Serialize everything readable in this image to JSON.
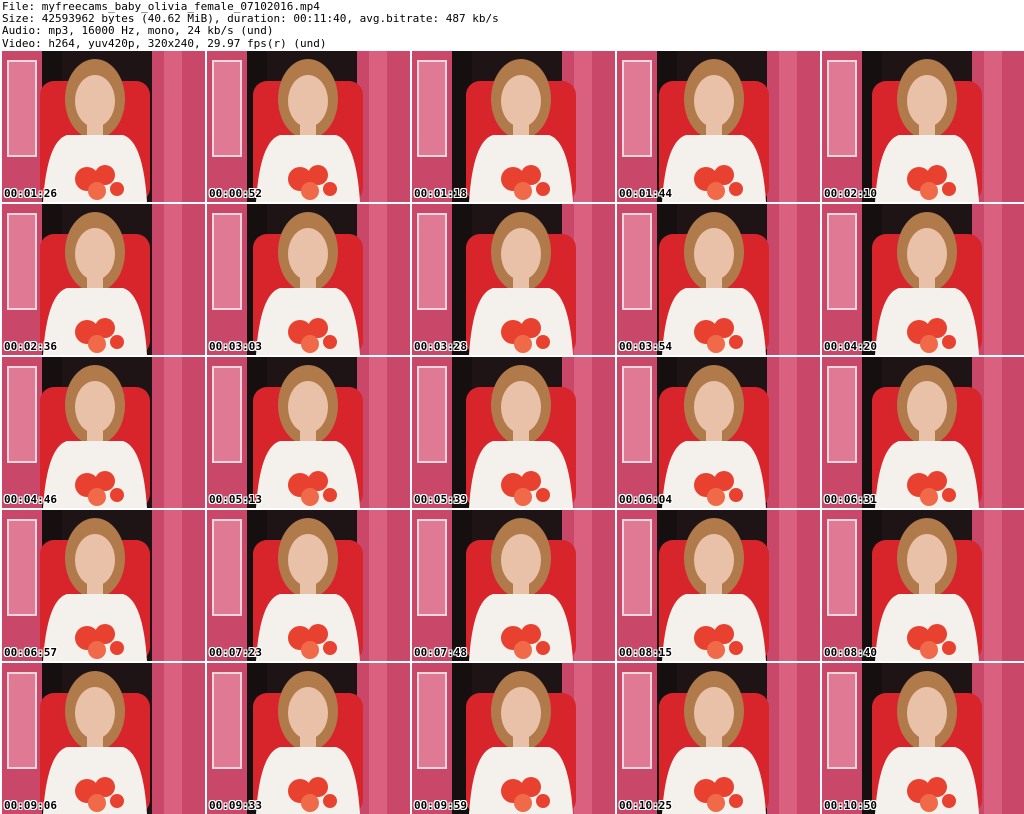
{
  "header": {
    "line1": "File: myfreecams_baby_olivia_female_07102016.mp4",
    "line2": "Size: 42593962 bytes (40.62 MiB), duration: 00:11:40, avg.bitrate: 487 kb/s",
    "line3": "Audio: mp3, 16000 Hz, mono, 24 kb/s (und)",
    "line4": "Video: h264, yuv420p, 320x240, 29.97 fps(r) (und)"
  },
  "colors": {
    "wall_pink": "#c9486a",
    "chair_red": "#d8252c",
    "top_white": "#f4f0ec",
    "print_red": "#e8412f",
    "hair": "#b07a4a",
    "skin": "#e9c1a8",
    "dark_bg": "#1e1416"
  },
  "thumbnails": [
    {
      "time": "00:01:26"
    },
    {
      "time": "00:00:52"
    },
    {
      "time": "00:01:18"
    },
    {
      "time": "00:01:44"
    },
    {
      "time": "00:02:10"
    },
    {
      "time": "00:02:36"
    },
    {
      "time": "00:03:03"
    },
    {
      "time": "00:03:28"
    },
    {
      "time": "00:03:54"
    },
    {
      "time": "00:04:20"
    },
    {
      "time": "00:04:46"
    },
    {
      "time": "00:05:13"
    },
    {
      "time": "00:05:39"
    },
    {
      "time": "00:06:04"
    },
    {
      "time": "00:06:31"
    },
    {
      "time": "00:06:57"
    },
    {
      "time": "00:07:23"
    },
    {
      "time": "00:07:48"
    },
    {
      "time": "00:08:15"
    },
    {
      "time": "00:08:40"
    },
    {
      "time": "00:09:06"
    },
    {
      "time": "00:09:33"
    },
    {
      "time": "00:09:59"
    },
    {
      "time": "00:10:25"
    },
    {
      "time": "00:10:50"
    }
  ]
}
